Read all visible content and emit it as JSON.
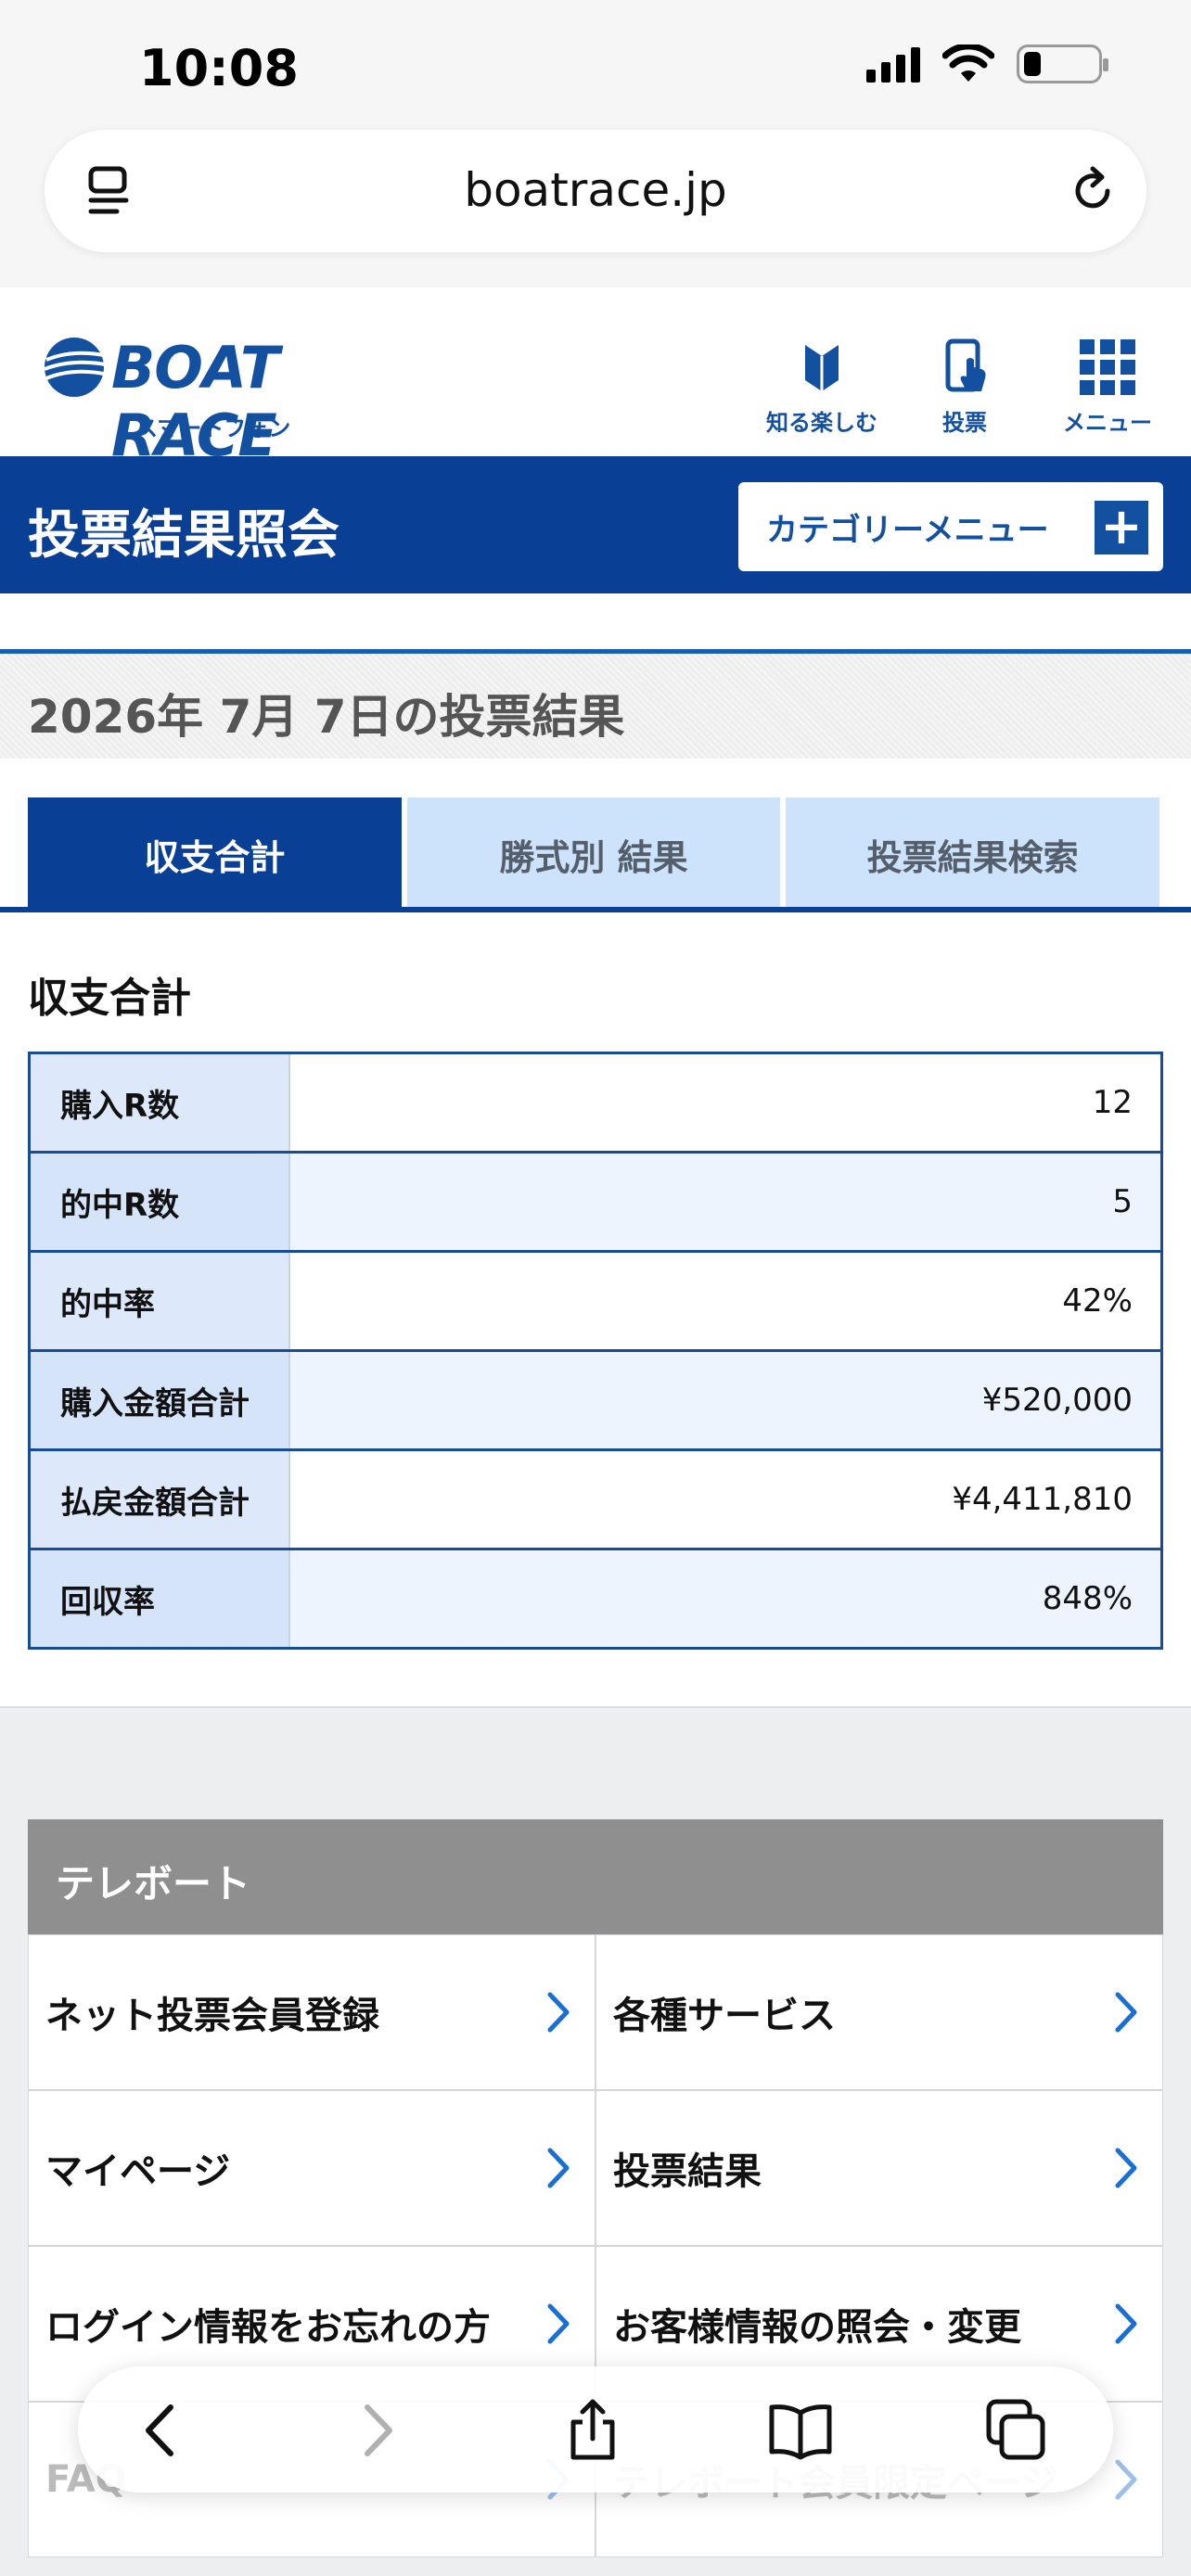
{
  "status": {
    "time": "10:08"
  },
  "browser": {
    "url": "boatrace.jp"
  },
  "site": {
    "logo": "BOAT RACE",
    "logo_sub": "スマートフォン",
    "nav": [
      {
        "label": "知る楽しむ",
        "icon": "beginner-mark-icon"
      },
      {
        "label": "投票",
        "icon": "phone-tap-icon"
      },
      {
        "label": "メニュー",
        "icon": "grid-menu-icon"
      }
    ]
  },
  "page": {
    "title": "投票結果照会",
    "category_button": "カテゴリーメニュー",
    "date_heading": "2026年 7月 7日の投票結果",
    "tabs": [
      {
        "label": "収支合計",
        "active": true
      },
      {
        "label": "勝式別 結果",
        "active": false
      },
      {
        "label": "投票結果検索",
        "active": false
      }
    ],
    "section_title": "収支合計",
    "summary": [
      {
        "label": "購入R数",
        "value": "12"
      },
      {
        "label": "的中R数",
        "value": "5"
      },
      {
        "label": "的中率",
        "value": "42%"
      },
      {
        "label": "購入金額合計",
        "value": "¥520,000"
      },
      {
        "label": "払戻金額合計",
        "value": "¥4,411,810"
      },
      {
        "label": "回収率",
        "value": "848%"
      }
    ]
  },
  "teleboat": {
    "title": "テレボート",
    "links": [
      "ネット投票会員登録",
      "各種サービス",
      "マイページ",
      "投票結果",
      "ログイン情報をお忘れの方",
      "お客様情報の照会・変更",
      "FAQ",
      "テレボート会員限定ページ"
    ]
  },
  "colors": {
    "brand": "#0a3f96",
    "tab_inactive": "#cde2fb",
    "header_gray": "#8f8f8f"
  }
}
